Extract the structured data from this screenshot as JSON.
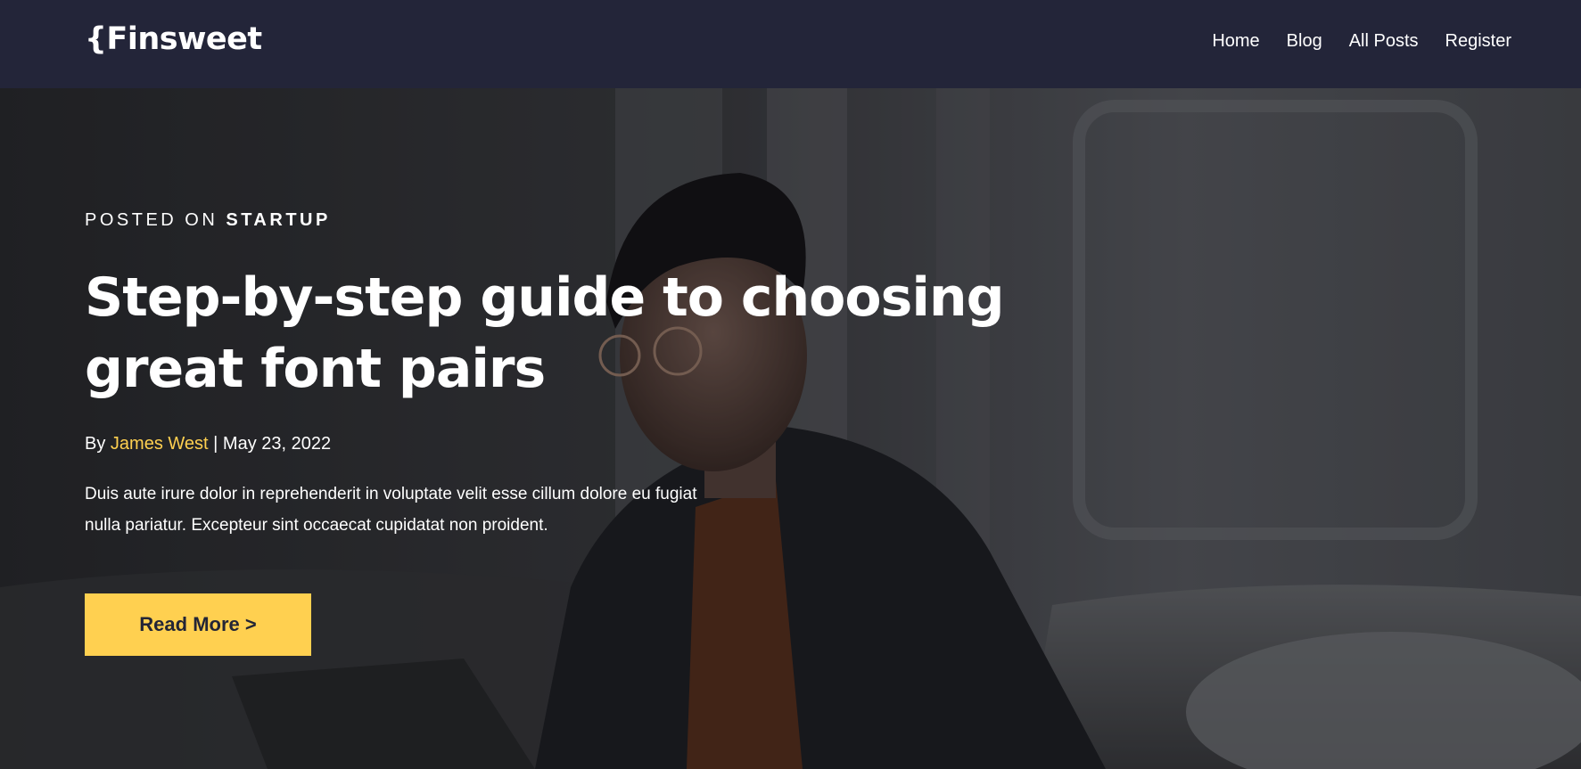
{
  "brand": {
    "logo_text": "{Finsweet"
  },
  "nav": {
    "items": [
      {
        "label": "Home"
      },
      {
        "label": "Blog"
      },
      {
        "label": "All Posts"
      },
      {
        "label": "Register"
      }
    ]
  },
  "hero": {
    "posted_prefix": "POSTED ON",
    "category": "STARTUP",
    "title": "Step-by-step guide to choosing great font pairs",
    "byline_prefix": "By",
    "author": "James West",
    "separator": "|",
    "date": "May 23, 2022",
    "excerpt": "Duis aute irure dolor in reprehenderit in voluptate velit esse cillum dolore eu fugiat nulla pariatur. Excepteur sint occaecat cupidatat non proident.",
    "cta_label": "Read More >"
  },
  "colors": {
    "navbar_bg": "#232539",
    "accent": "#ffd050",
    "text": "#ffffff"
  }
}
